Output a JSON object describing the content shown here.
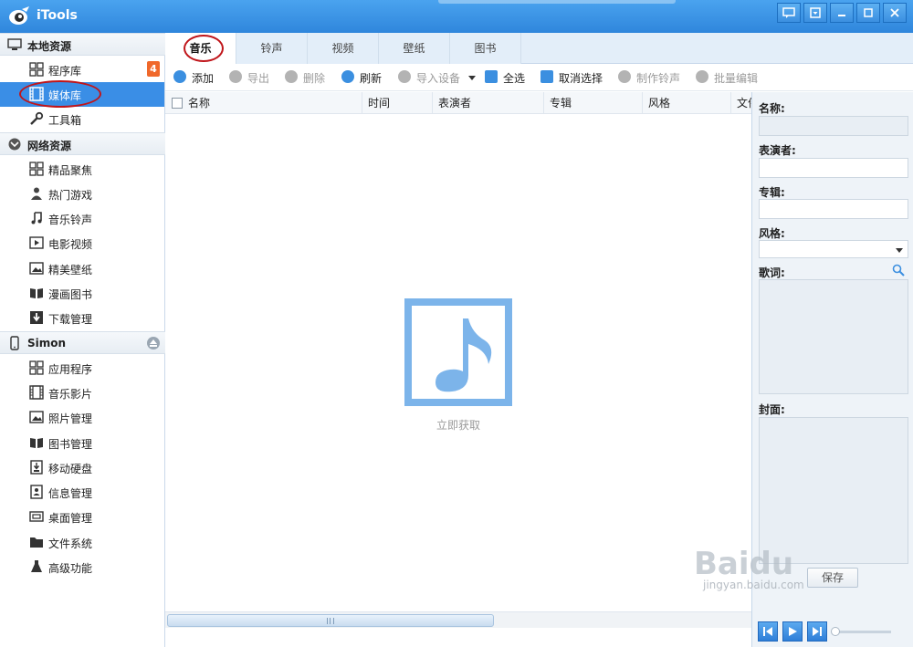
{
  "app": {
    "title": "iTools"
  },
  "sidebar": {
    "local": {
      "header": "本地资源",
      "items": [
        {
          "label": "程序库",
          "badge": "4"
        },
        {
          "label": "媒体库"
        },
        {
          "label": "工具箱"
        }
      ]
    },
    "network": {
      "header": "网络资源",
      "items": [
        {
          "label": "精品聚焦"
        },
        {
          "label": "热门游戏"
        },
        {
          "label": "音乐铃声"
        },
        {
          "label": "电影视频"
        },
        {
          "label": "精美壁纸"
        },
        {
          "label": "漫画图书"
        },
        {
          "label": "下载管理"
        }
      ]
    },
    "device": {
      "header": "Simon",
      "items": [
        {
          "label": "应用程序"
        },
        {
          "label": "音乐影片"
        },
        {
          "label": "照片管理"
        },
        {
          "label": "图书管理"
        },
        {
          "label": "移动硬盘"
        },
        {
          "label": "信息管理"
        },
        {
          "label": "桌面管理"
        },
        {
          "label": "文件系统"
        },
        {
          "label": "高级功能"
        }
      ]
    }
  },
  "tabs": [
    "音乐",
    "铃声",
    "视频",
    "壁纸",
    "图书"
  ],
  "toolbar": {
    "add": "添加",
    "export": "导出",
    "delete": "删除",
    "refresh": "刷新",
    "import": "导入设备",
    "select_all": "全选",
    "deselect": "取消选择",
    "make_ringtone": "制作铃声",
    "batch_edit": "批量编辑"
  },
  "columns": [
    "名称",
    "时间",
    "表演者",
    "专辑",
    "风格",
    "文件"
  ],
  "empty": {
    "link": "立即获取"
  },
  "details": {
    "name_label": "名称:",
    "artist_label": "表演者:",
    "album_label": "专辑:",
    "genre_label": "风格:",
    "lyrics_label": "歌词:",
    "cover_label": "封面:",
    "save_label": "保存"
  },
  "watermark": {
    "brand": "Baidu",
    "url": "jingyan.baidu.com"
  },
  "colors": {
    "accent": "#3a8ee6",
    "titlebar": "#3b8fe0",
    "badge": "#f0682a",
    "highlight_oval": "#c0151a"
  }
}
